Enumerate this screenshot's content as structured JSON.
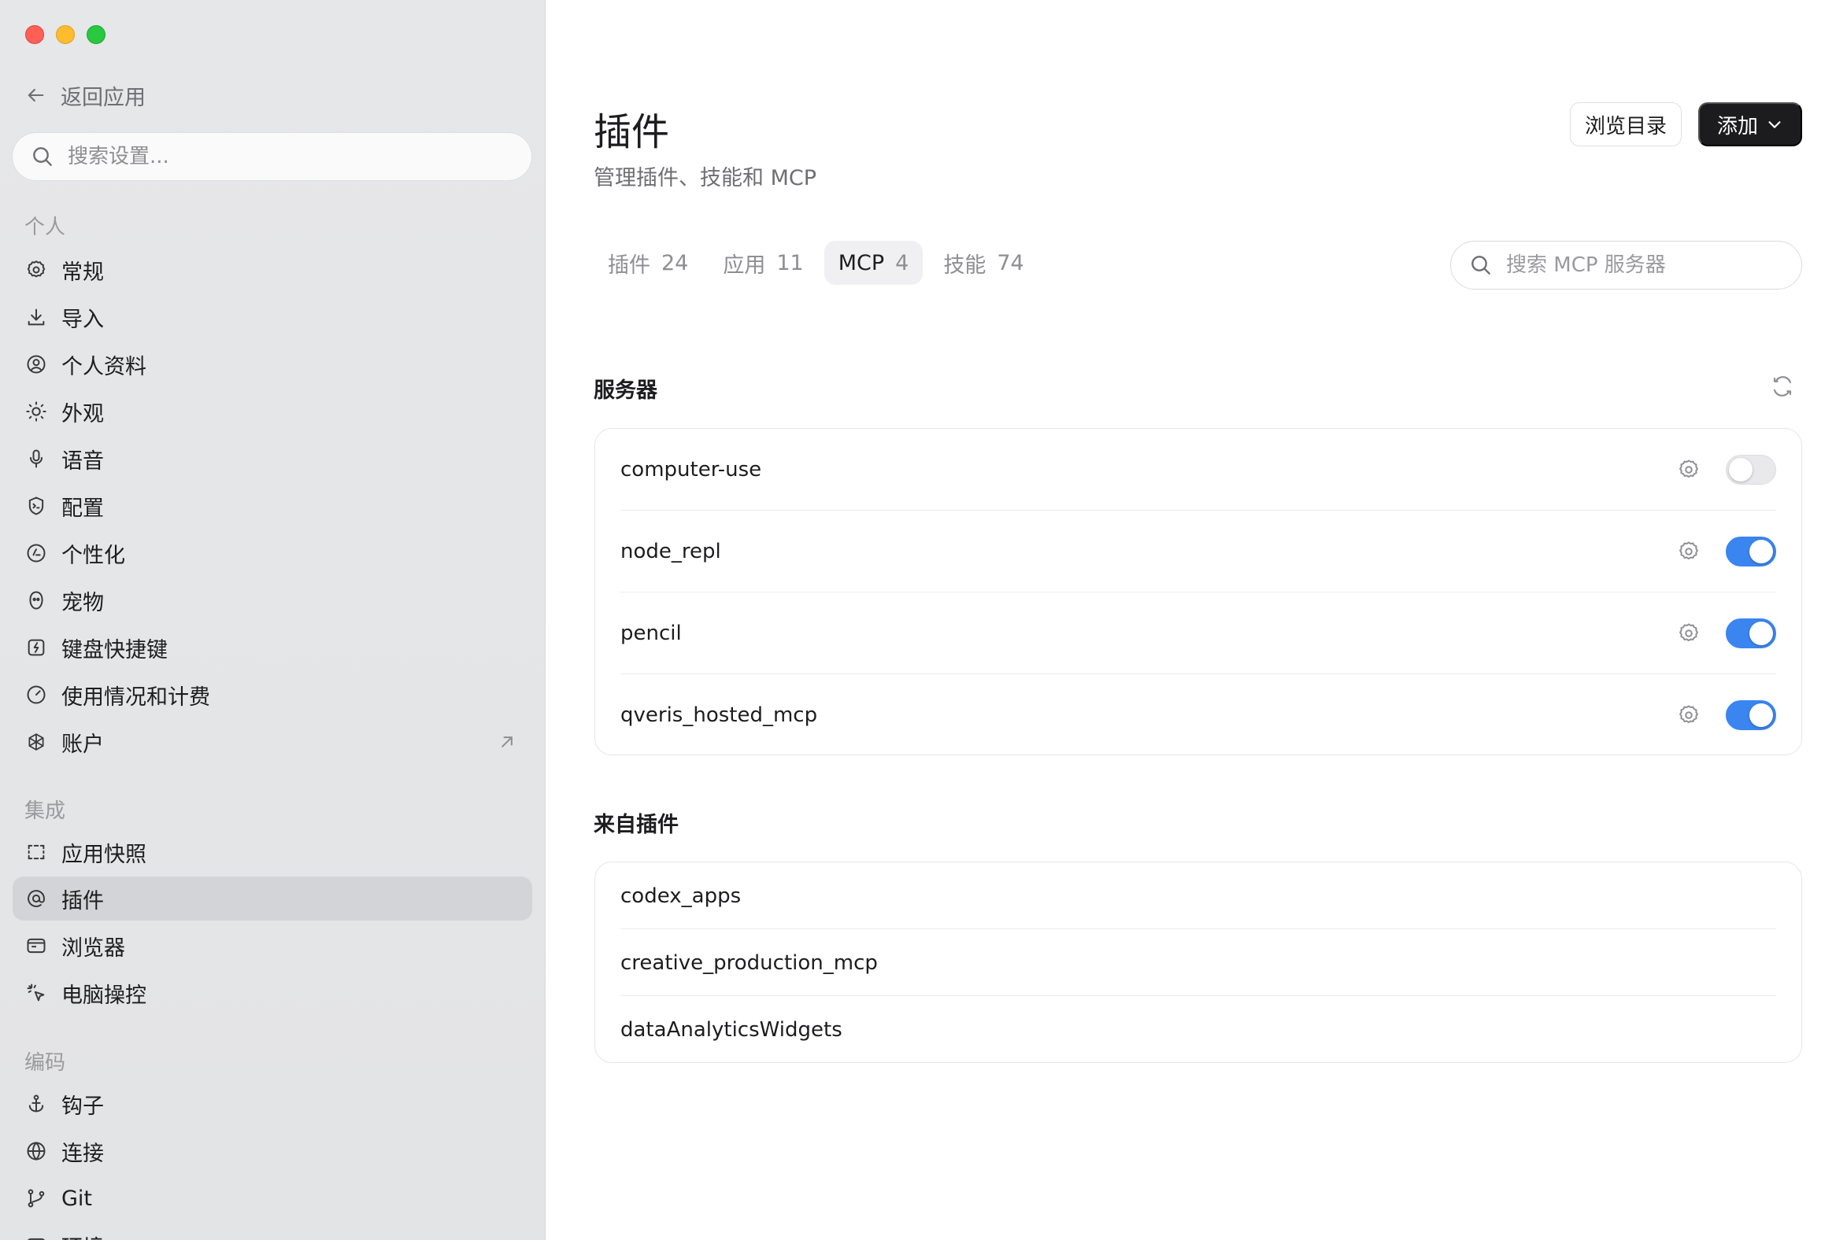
{
  "sidebar": {
    "back_label": "返回应用",
    "search_placeholder": "搜索设置...",
    "sections": {
      "personal": "个人",
      "integrations": "集成",
      "coding": "编码"
    },
    "personal_items": [
      {
        "label": "常规",
        "icon": "gear-icon"
      },
      {
        "label": "导入",
        "icon": "download-icon"
      },
      {
        "label": "个人资料",
        "icon": "profile-icon"
      },
      {
        "label": "外观",
        "icon": "sun-icon"
      },
      {
        "label": "语音",
        "icon": "microphone-icon"
      },
      {
        "label": "配置",
        "icon": "config-shield-icon"
      },
      {
        "label": "个性化",
        "icon": "personalize-icon"
      },
      {
        "label": "宠物",
        "icon": "pet-icon"
      },
      {
        "label": "键盘快捷键",
        "icon": "keyboard-shortcut-icon"
      },
      {
        "label": "使用情况和计费",
        "icon": "gauge-icon"
      },
      {
        "label": "账户",
        "icon": "openai-logo-icon"
      }
    ],
    "integration_items": [
      {
        "label": "应用快照",
        "icon": "snapshot-icon"
      },
      {
        "label": "插件",
        "icon": "at-icon",
        "active": true
      },
      {
        "label": "浏览器",
        "icon": "browser-icon"
      },
      {
        "label": "电脑操控",
        "icon": "cursor-click-icon"
      }
    ],
    "coding_items": [
      {
        "label": "钩子",
        "icon": "anchor-icon"
      },
      {
        "label": "连接",
        "icon": "globe-icon"
      },
      {
        "label": "Git",
        "icon": "git-branch-icon"
      },
      {
        "label": "环境",
        "icon": "environment-icon"
      }
    ]
  },
  "main": {
    "title": "插件",
    "subtitle": "管理插件、技能和 MCP",
    "browse_label": "浏览目录",
    "add_label": "添加",
    "tabs": [
      {
        "label": "插件",
        "count": "24"
      },
      {
        "label": "应用",
        "count": "11"
      },
      {
        "label": "MCP",
        "count": "4",
        "active": true
      },
      {
        "label": "技能",
        "count": "74"
      }
    ],
    "search_placeholder": "搜索 MCP 服务器",
    "servers_heading": "服务器",
    "servers": [
      {
        "name": "computer-use",
        "enabled": false
      },
      {
        "name": "node_repl",
        "enabled": true
      },
      {
        "name": "pencil",
        "enabled": true
      },
      {
        "name": "qveris_hosted_mcp",
        "enabled": true
      }
    ],
    "from_plugins_heading": "来自插件",
    "from_plugins": [
      {
        "name": "codex_apps"
      },
      {
        "name": "creative_production_mcp"
      },
      {
        "name": "dataAnalyticsWidgets"
      }
    ]
  },
  "colors": {
    "accent": "#3a85f0",
    "primary_button": "#1c1c1e",
    "sidebar_bg": "#e4e5e7"
  }
}
